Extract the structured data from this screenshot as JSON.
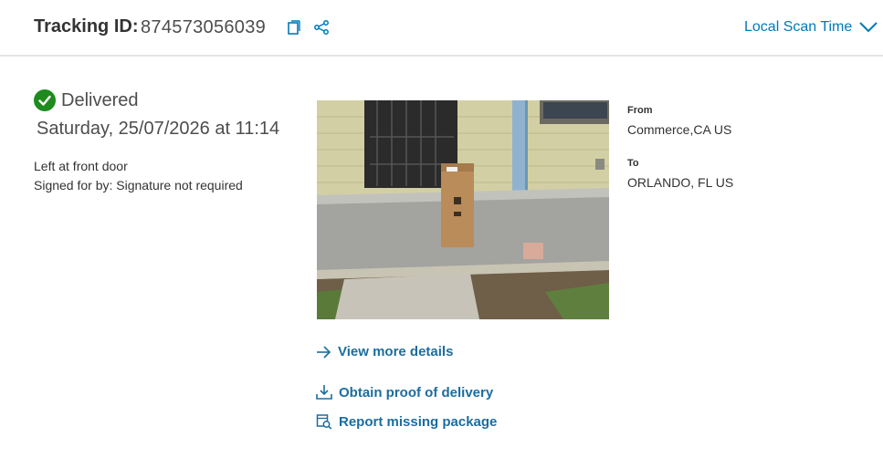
{
  "header": {
    "tracking_label": "Tracking ID:",
    "tracking_id": "874573056039",
    "scan_time_label": "Local Scan Time",
    "accent_color": "#007ab7",
    "icons": [
      "copy-icon",
      "share-icon",
      "chevron-down-icon"
    ]
  },
  "status": {
    "label": "Delivered",
    "datetime": "Saturday, 25/07/2026 at 11:14",
    "lines": [
      "Left at front door",
      "Signed for by: Signature not required"
    ],
    "color": "#1e8b1e"
  },
  "route": {
    "from_label": "From",
    "from_value": "Commerce,CA US",
    "to_label": "To",
    "to_value": "ORLANDO, FL US"
  },
  "actions": [
    {
      "label": "View more details",
      "icon": "arrow-right-icon"
    },
    {
      "label": "Obtain proof of delivery",
      "icon": "download-icon"
    },
    {
      "label": "Report missing package",
      "icon": "search-package-icon"
    }
  ]
}
